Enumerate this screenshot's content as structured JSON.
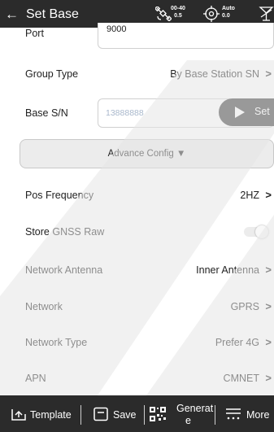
{
  "header": {
    "back_icon": "arrow-left-icon",
    "title": "Set Base",
    "status": {
      "satellite_icon": "satellite-icon",
      "sat_top": "00-40",
      "sat_bottom": "0.5",
      "target_icon": "crosshair-target-icon",
      "fix_top": "Auto",
      "fix_bottom": "0.0",
      "antenna_icon": "antenna-icon"
    }
  },
  "form": {
    "port": {
      "label": "Port",
      "value": "9000"
    },
    "group_type": {
      "label": "Group Type",
      "value": "By Base Station SN"
    },
    "base_sn": {
      "label": "Base S/N",
      "value": "13888888",
      "set_label": "Set"
    },
    "advance_config": {
      "label": "Advance Config ▼"
    },
    "pos_frequency": {
      "label": "Pos Frequency",
      "value": "2HZ"
    },
    "store_gnss_raw": {
      "label": "Store GNSS Raw",
      "enabled": false
    },
    "network_antenna": {
      "label": "Network Antenna",
      "value": "Inner Antenna"
    },
    "network": {
      "label": "Network",
      "value": "GPRS"
    },
    "network_type": {
      "label": "Network Type",
      "value": "Prefer 4G"
    },
    "apn": {
      "label": "APN",
      "value": "CMNET"
    }
  },
  "chevron": ">",
  "toolbar": {
    "template_label": "Template",
    "save_label": "Save",
    "generate_line1": "Generat",
    "generate_line2": "e",
    "more_label": "More"
  },
  "colors": {
    "header_bg": "#2b2b2b",
    "set_button_bg": "#3d3d3d",
    "placeholder_text": "#a9b8cc",
    "advance_bg": "#ececec"
  }
}
